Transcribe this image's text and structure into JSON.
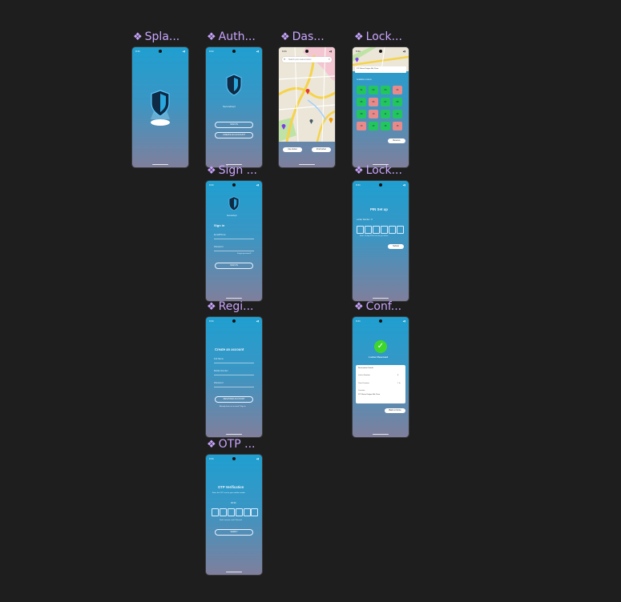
{
  "frames": {
    "splash": {
      "label": "Spla..."
    },
    "auth": {
      "label": "Auth...",
      "brand": "SecureKept",
      "signin": "SIGN IN",
      "create": "CREATE AN ACCOUNT"
    },
    "dashboard": {
      "label": "Das...",
      "search_placeholder": "Search your nearest locker",
      "btn_left": "Use locker",
      "btn_right": "Find locker"
    },
    "locker_select": {
      "label": "Lock...",
      "address": "2/1 Vilnius Katiyar Rd, Pune",
      "section": "Available Lockers",
      "button": "Reserve",
      "lockers": [
        {
          "n": "01",
          "s": "g"
        },
        {
          "n": "02",
          "s": "g"
        },
        {
          "n": "03",
          "s": "g"
        },
        {
          "n": "04",
          "s": "r"
        },
        {
          "n": "05",
          "s": "g"
        },
        {
          "n": "06",
          "s": "r"
        },
        {
          "n": "07",
          "s": "g"
        },
        {
          "n": "08",
          "s": "g"
        },
        {
          "n": "09",
          "s": "g"
        },
        {
          "n": "10",
          "s": "r"
        },
        {
          "n": "11",
          "s": "g"
        },
        {
          "n": "12",
          "s": "g"
        },
        {
          "n": "13",
          "s": "r"
        },
        {
          "n": "14",
          "s": "g"
        },
        {
          "n": "15",
          "s": "g"
        },
        {
          "n": "16",
          "s": "r"
        }
      ]
    },
    "signin": {
      "label": "Sign ...",
      "brand": "SecureKept",
      "heading": "Sign in",
      "email": "Email/Phone",
      "password": "Password",
      "forgot": "Forgot password?",
      "button": "SIGN IN"
    },
    "pin_setup": {
      "label": "Lock...",
      "heading": "PIN Set up",
      "sub": "Locker Number : 8",
      "hint": "Enter a 6-digit PIN to secure your locker",
      "button": "Submit"
    },
    "register": {
      "label": "Regi...",
      "heading": "Create an account",
      "name": "Full Name",
      "phone": "Mobile Number",
      "password": "Password",
      "button": "REGISTER ACCOUNT",
      "footer": "Already have an account? Sign in"
    },
    "confirm": {
      "label": "Conf...",
      "heading": "Locker Reserved",
      "card_title": "Reservation Details",
      "row1_k": "Locker Number",
      "row1_v": "8",
      "row2_k": "Time Duration",
      "row2_v": "1 hr",
      "row3_k": "Location",
      "row3_v": "2/1 Vilnius Katiyar Rd, Pune",
      "button": "Back to home"
    },
    "otp": {
      "label": "OTP ...",
      "heading": "OTP Verification",
      "sub": "Enter the OTP sent to your mobile number",
      "timer": "00:30",
      "resend": "Didn't receive code? Resend",
      "button": "VERIFY"
    }
  },
  "colors": {
    "canvas": "#1e1e1e",
    "label": "#c9a5ff",
    "green": "#22c55e",
    "red": "#e88a8a"
  }
}
